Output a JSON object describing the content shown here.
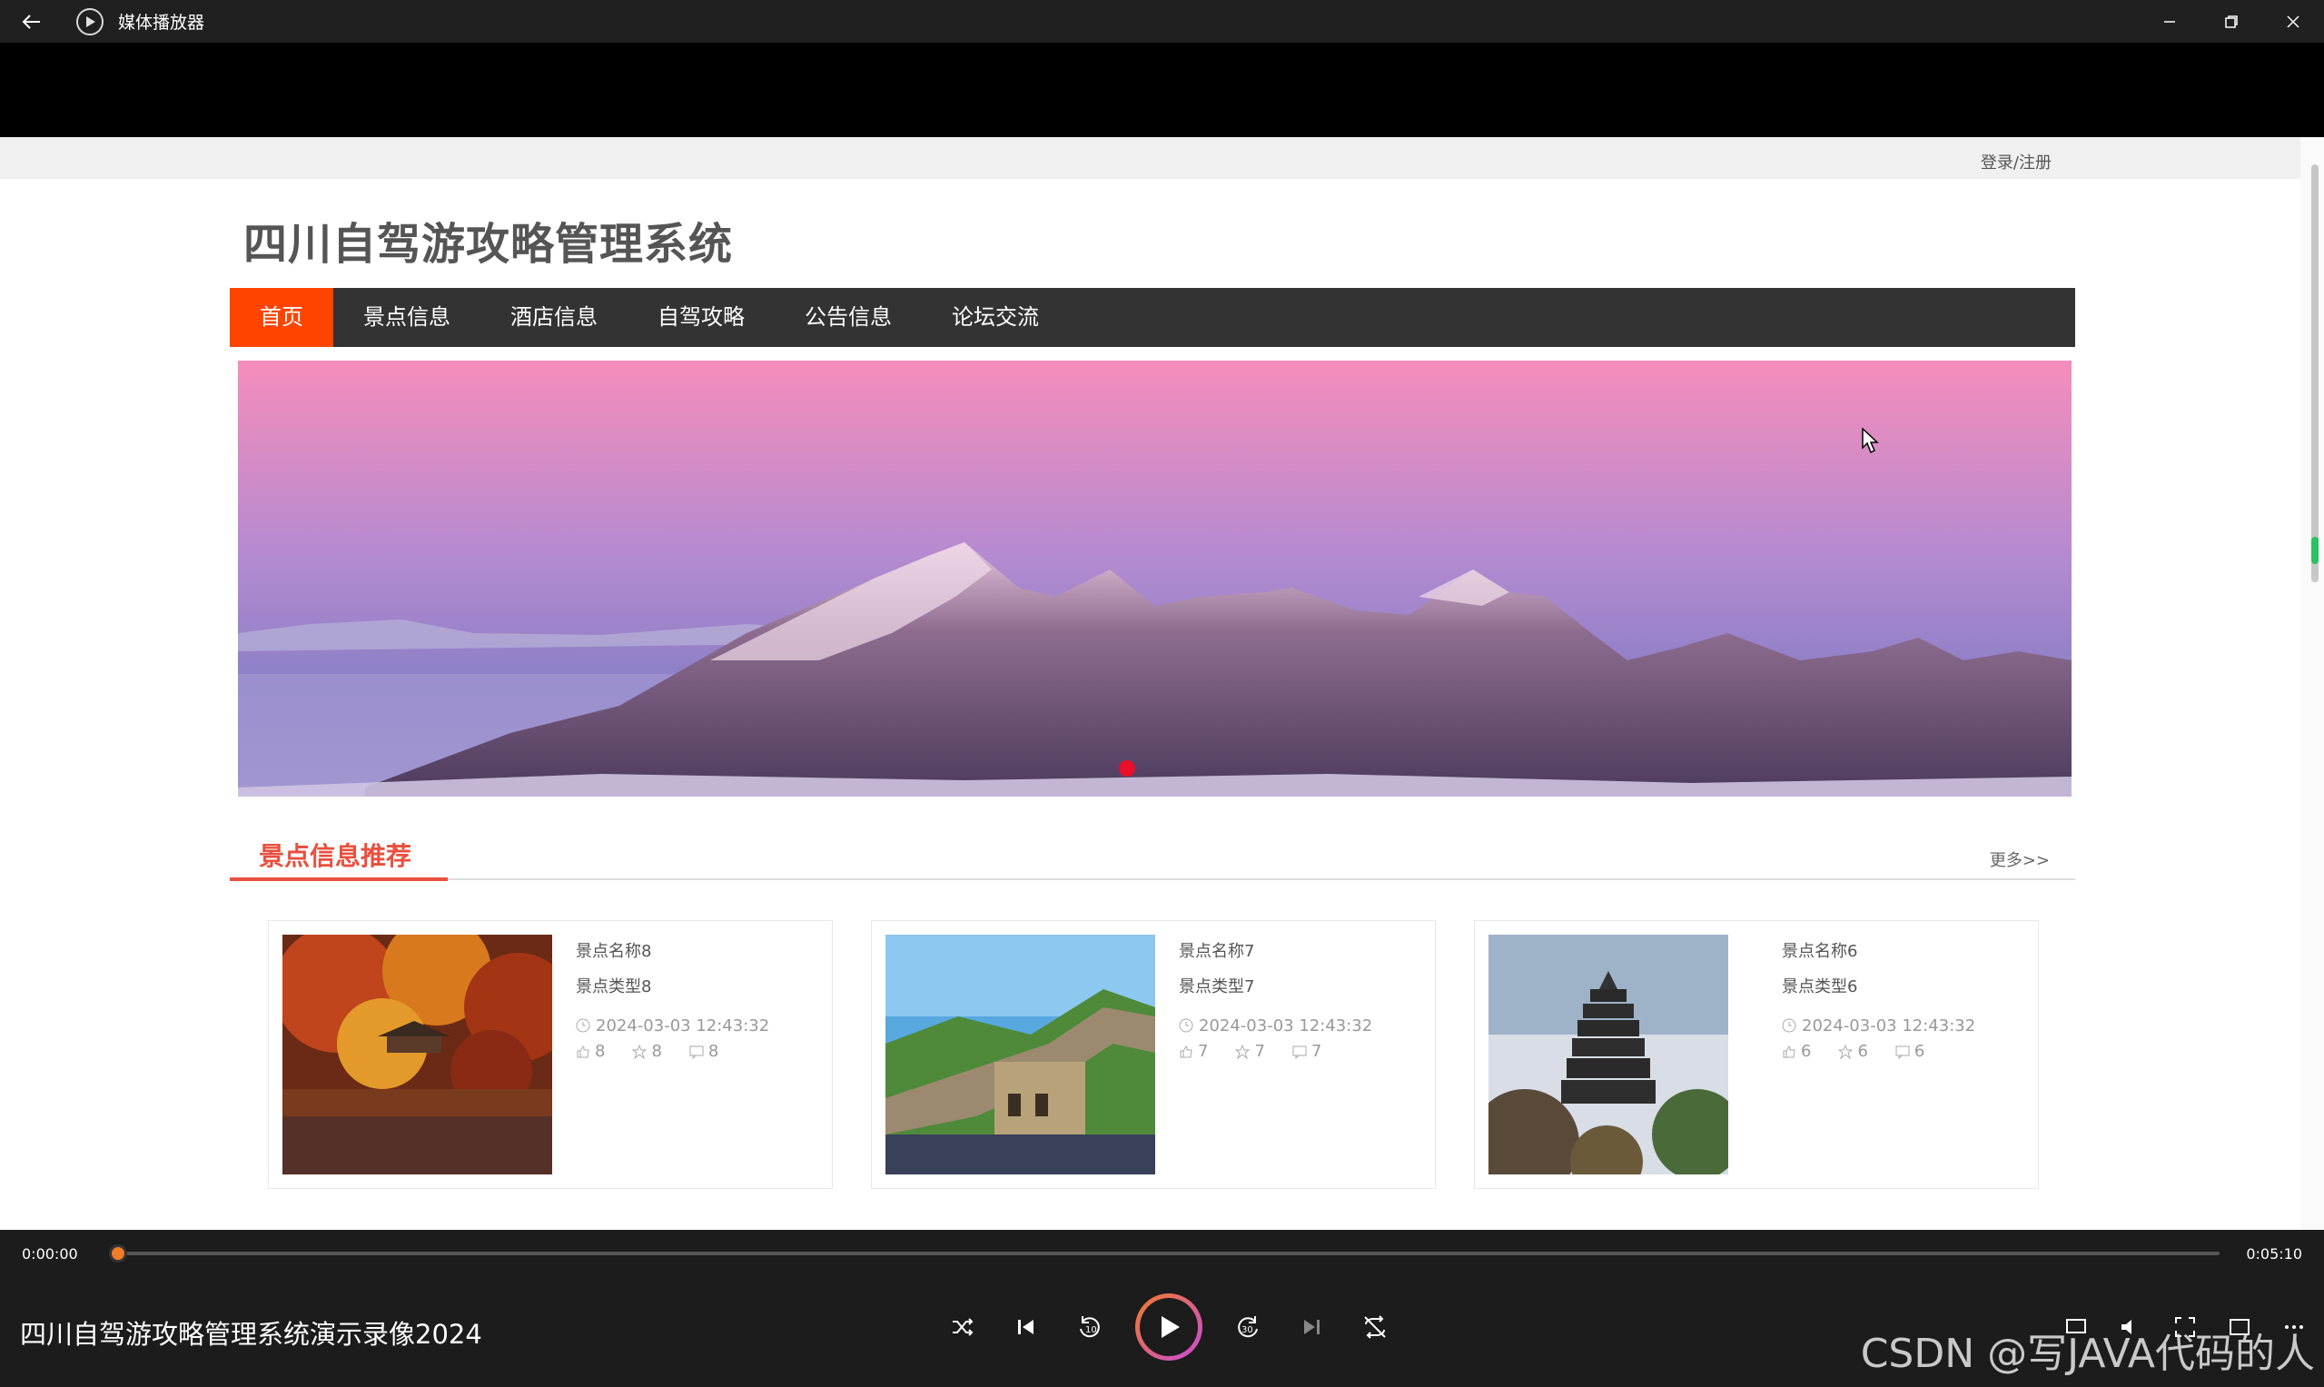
{
  "window": {
    "title": "媒体播放器",
    "icons": [
      "back-arrow-icon",
      "media-player-app-icon",
      "minimize-icon",
      "restore-icon",
      "close-icon"
    ]
  },
  "site": {
    "login_link": "登录/注册",
    "title": "四川自驾游攻略管理系统",
    "nav": [
      {
        "label": "首页",
        "active": true
      },
      {
        "label": "景点信息",
        "active": false
      },
      {
        "label": "酒店信息",
        "active": false
      },
      {
        "label": "自驾攻略",
        "active": false
      },
      {
        "label": "公告信息",
        "active": false
      },
      {
        "label": "论坛交流",
        "active": false
      }
    ],
    "section": {
      "title": "景点信息推荐",
      "more": "更多>>"
    },
    "cards": [
      {
        "name": "景点名称8",
        "type": "景点类型8",
        "date": "2024-03-03 12:43:32",
        "likes": "8",
        "favorites": "8",
        "comments": "8"
      },
      {
        "name": "景点名称7",
        "type": "景点类型7",
        "date": "2024-03-03 12:43:32",
        "likes": "7",
        "favorites": "7",
        "comments": "7"
      },
      {
        "name": "景点名称6",
        "type": "景点类型6",
        "date": "2024-03-03 12:43:32",
        "likes": "6",
        "favorites": "6",
        "comments": "6"
      }
    ]
  },
  "player": {
    "time_current": "0:00:00",
    "time_total": "0:05:10",
    "progress": 0.0,
    "media_title": "四川自驾游攻略管理系统演示录像2024",
    "watermark": "CSDN @写JAVA代码的人",
    "accent_color": "#f07c2a"
  }
}
